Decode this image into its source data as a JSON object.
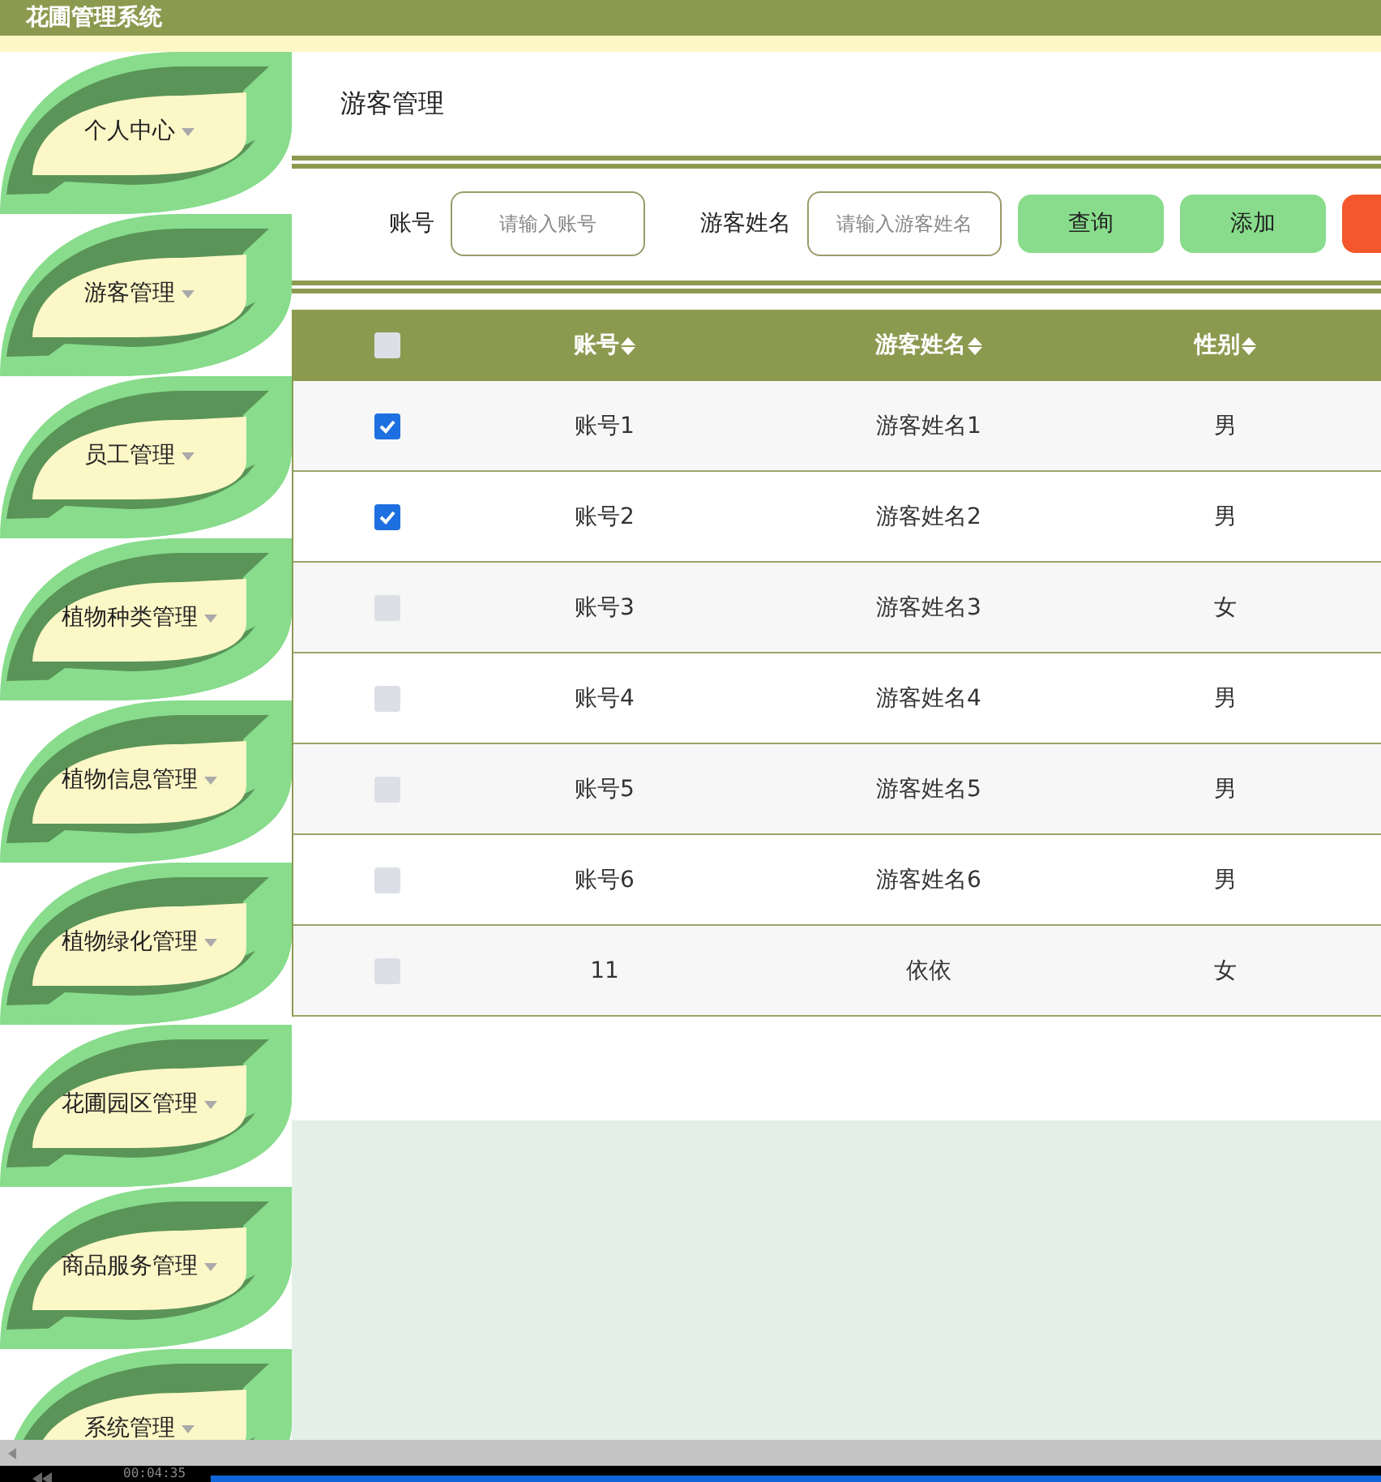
{
  "app_title": "花圃管理系统",
  "sidebar": {
    "items": [
      {
        "label": "个人中心"
      },
      {
        "label": "游客管理"
      },
      {
        "label": "员工管理"
      },
      {
        "label": "植物种类管理"
      },
      {
        "label": "植物信息管理"
      },
      {
        "label": "植物绿化管理"
      },
      {
        "label": "花圃园区管理"
      },
      {
        "label": "商品服务管理"
      },
      {
        "label": "系统管理"
      }
    ]
  },
  "page_title": "游客管理",
  "search": {
    "fields": [
      {
        "label": "账号",
        "placeholder": "请输入账号"
      },
      {
        "label": "游客姓名",
        "placeholder": "请输入游客姓名"
      }
    ],
    "buttons": [
      {
        "label": "查询",
        "kind": "primary"
      },
      {
        "label": "添加",
        "kind": "primary"
      },
      {
        "kind": "danger"
      }
    ]
  },
  "table": {
    "select_all": {
      "checked": false
    },
    "columns": [
      "账号",
      "游客姓名",
      "性别"
    ],
    "rows": [
      {
        "checked": true,
        "cells": [
          "账号1",
          "游客姓名1",
          "男"
        ]
      },
      {
        "checked": true,
        "cells": [
          "账号2",
          "游客姓名2",
          "男"
        ]
      },
      {
        "checked": false,
        "cells": [
          "账号3",
          "游客姓名3",
          "女"
        ]
      },
      {
        "checked": false,
        "cells": [
          "账号4",
          "游客姓名4",
          "男"
        ]
      },
      {
        "checked": false,
        "cells": [
          "账号5",
          "游客姓名5",
          "男"
        ]
      },
      {
        "checked": false,
        "cells": [
          "账号6",
          "游客姓名6",
          "男"
        ]
      },
      {
        "checked": false,
        "cells": [
          "11",
          "依依",
          "女"
        ]
      }
    ]
  },
  "player": {
    "time": "00:04:35"
  }
}
